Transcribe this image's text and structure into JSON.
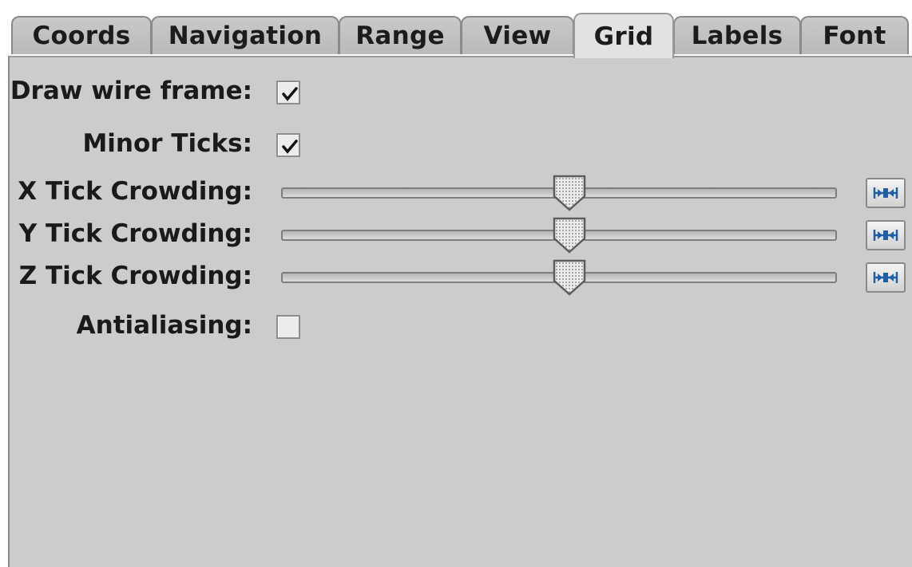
{
  "tabs": [
    {
      "label": "Coords",
      "active": false
    },
    {
      "label": "Navigation",
      "active": false
    },
    {
      "label": "Range",
      "active": false
    },
    {
      "label": "View",
      "active": false
    },
    {
      "label": "Grid",
      "active": true
    },
    {
      "label": "Labels",
      "active": false
    },
    {
      "label": "Font",
      "active": false
    }
  ],
  "grid": {
    "wire_frame": {
      "label": "Draw wire frame:",
      "checked": true
    },
    "minor_ticks": {
      "label": "Minor Ticks:",
      "checked": true
    },
    "x_crowding": {
      "label": "X Tick Crowding:",
      "value": 0.52
    },
    "y_crowding": {
      "label": "Y Tick Crowding:",
      "value": 0.52
    },
    "z_crowding": {
      "label": "Z Tick Crowding:",
      "value": 0.52
    },
    "antialiasing": {
      "label": "Antialiasing:",
      "checked": false
    }
  },
  "icons": {
    "reset": "reset-center-icon",
    "check": "checkmark-icon"
  },
  "colors": {
    "panel_bg": "#cccccc",
    "reset_icon": "#1f5fa8"
  }
}
